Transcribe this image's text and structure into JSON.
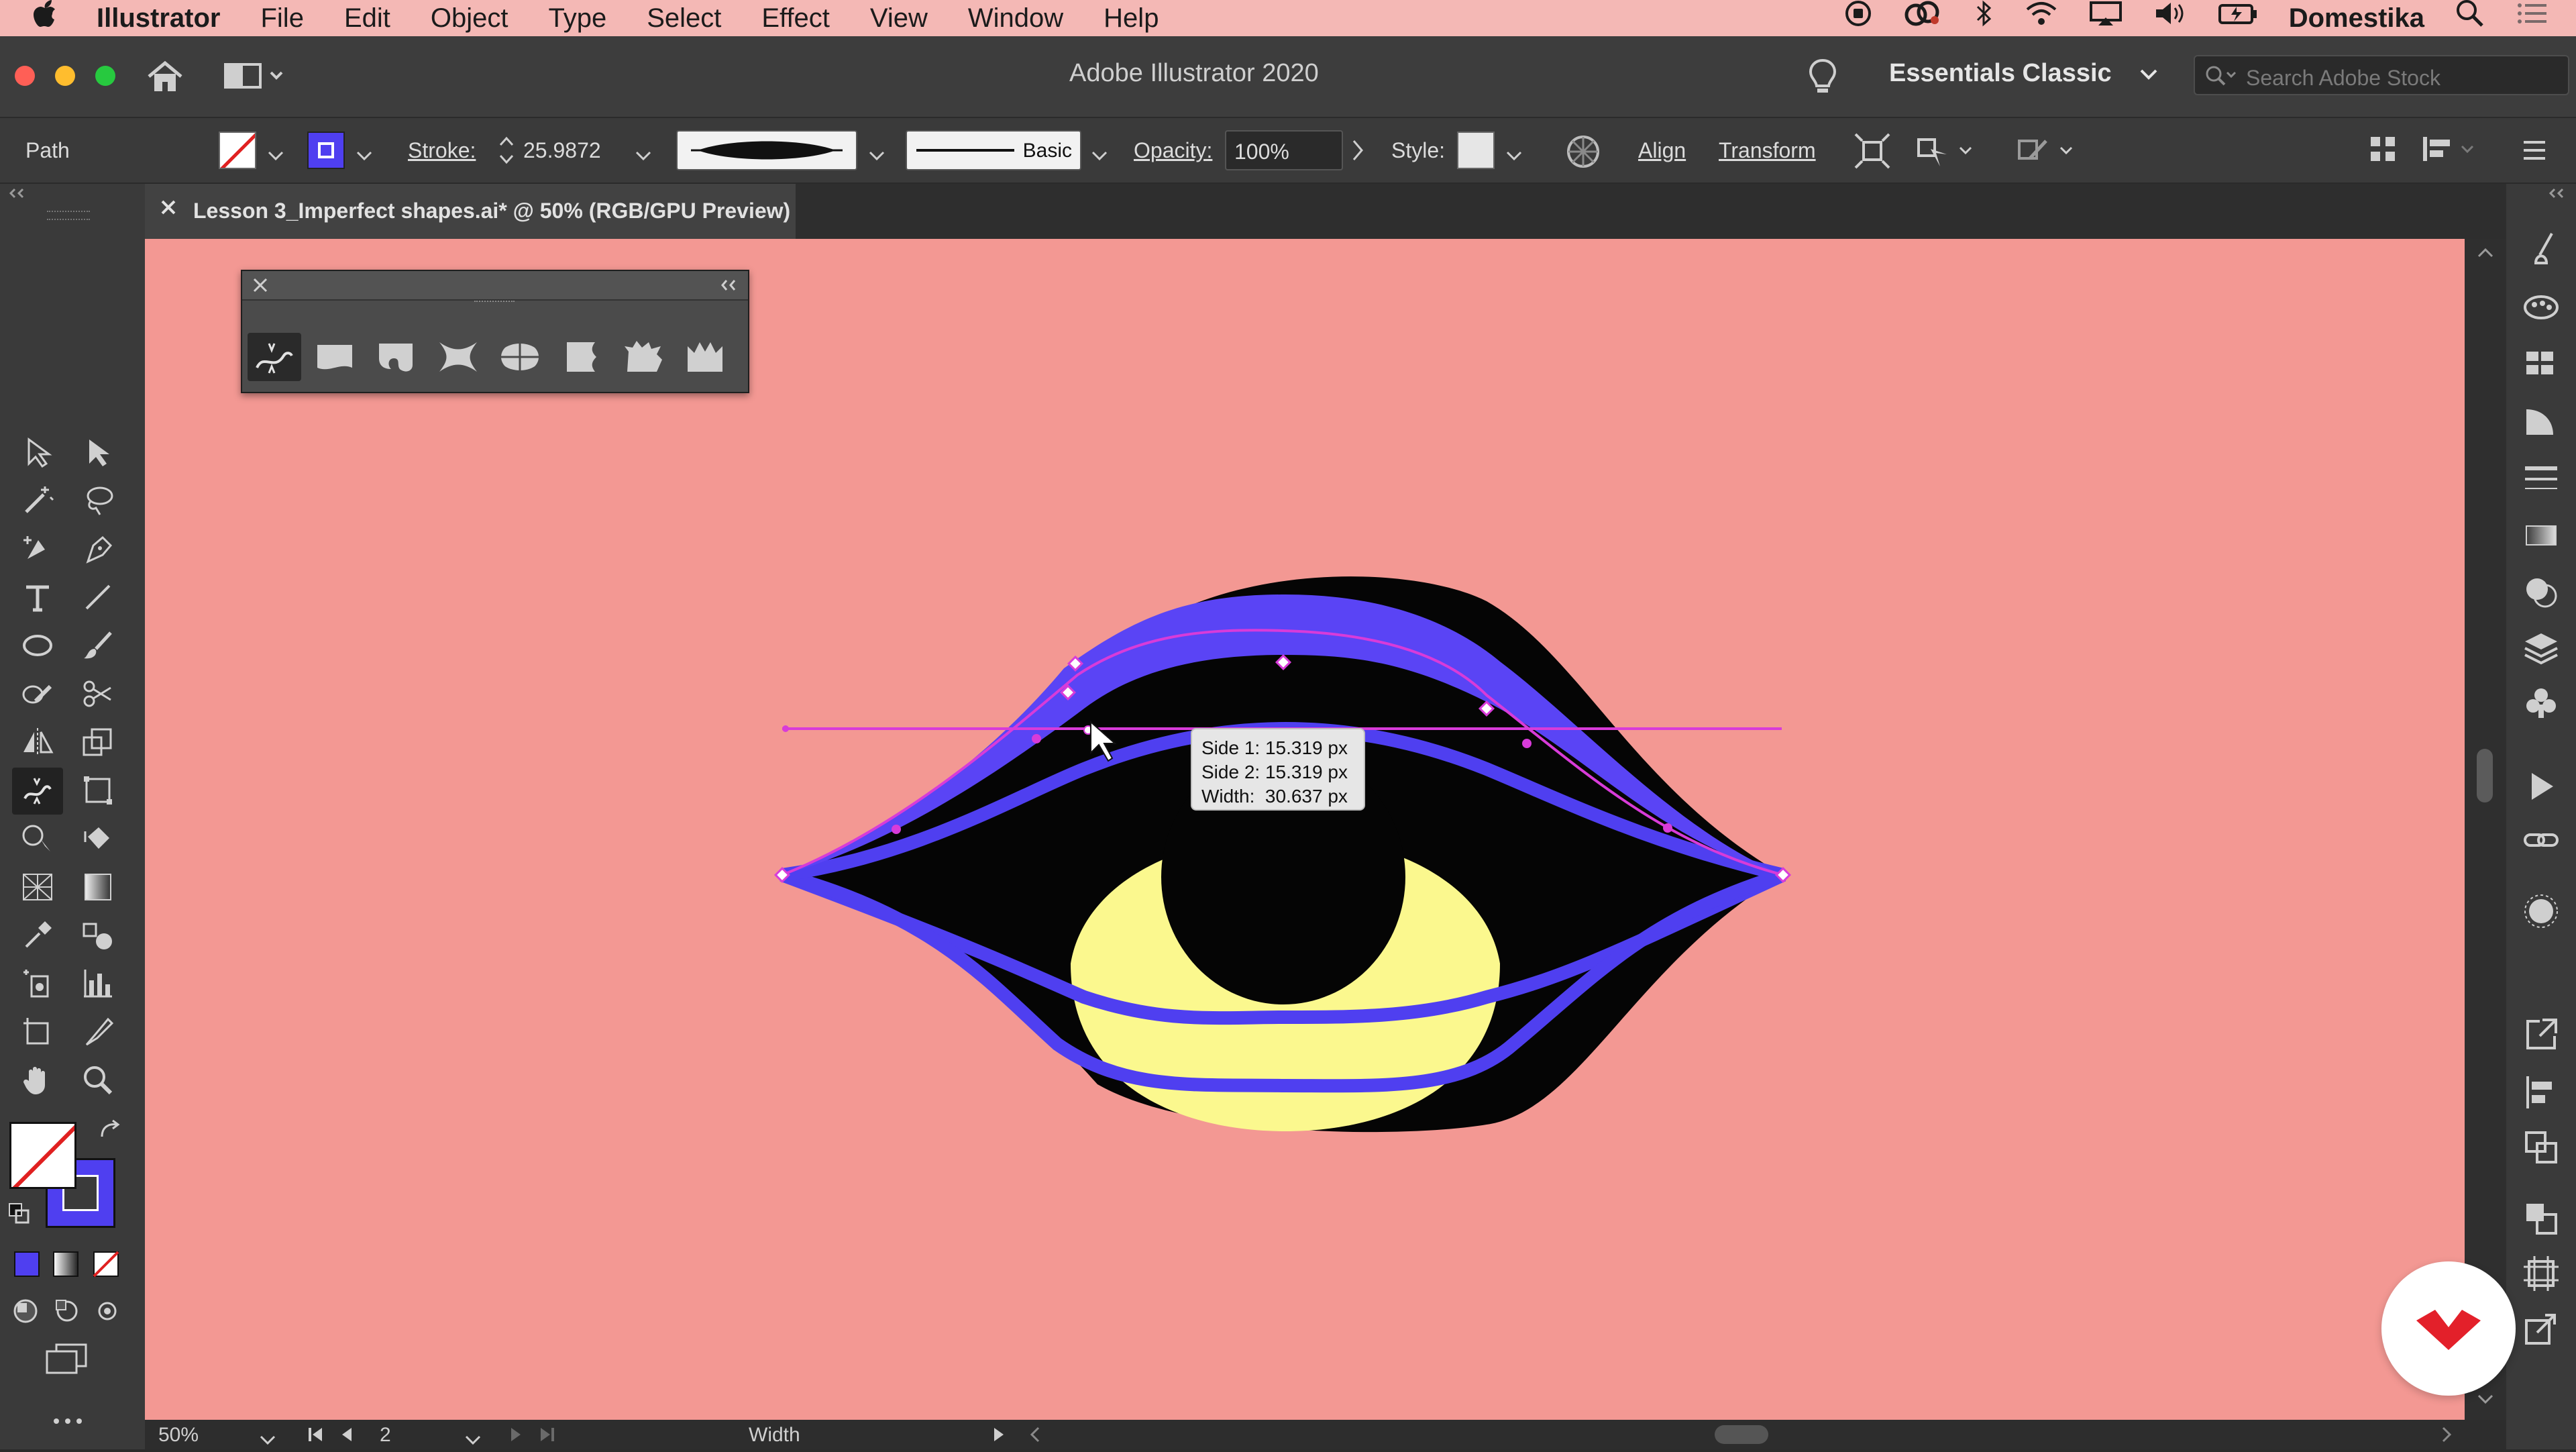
{
  "menubar": {
    "apple_icon": "apple-logo-icon",
    "app_name": "Illustrator",
    "items": [
      "File",
      "Edit",
      "Object",
      "Type",
      "Select",
      "Effect",
      "View",
      "Window",
      "Help"
    ],
    "status_user": "Domestika"
  },
  "titlebar": {
    "title": "Adobe Illustrator 2020",
    "workspace": "Essentials Classic",
    "search_placeholder": "Search Adobe Stock"
  },
  "controlbar": {
    "selection_type": "Path",
    "stroke_label": "Stroke:",
    "stroke_value": "25.9872",
    "brush_label": "Basic",
    "opacity_label": "Opacity:",
    "opacity_value": "100%",
    "style_label": "Style:",
    "align_label": "Align",
    "transform_label": "Transform"
  },
  "document_tab": {
    "title": "Lesson 3_Imperfect shapes.ai* @ 50% (RGB/GPU Preview)"
  },
  "tooltip": {
    "side1": "Side 1: 15.319 px",
    "side2": "Side 2: 15.319 px",
    "width": "Width:  30.637 px"
  },
  "statusbar": {
    "zoom": "50%",
    "artboard": "2",
    "tool_name": "Width"
  },
  "colors": {
    "canvas": "#f39893",
    "stroke_blue": "#4f3ff0",
    "eye_yellow": "#fbf88e",
    "selection_magenta": "#d83bd9",
    "menubar_bg": "#f4b8b5"
  }
}
